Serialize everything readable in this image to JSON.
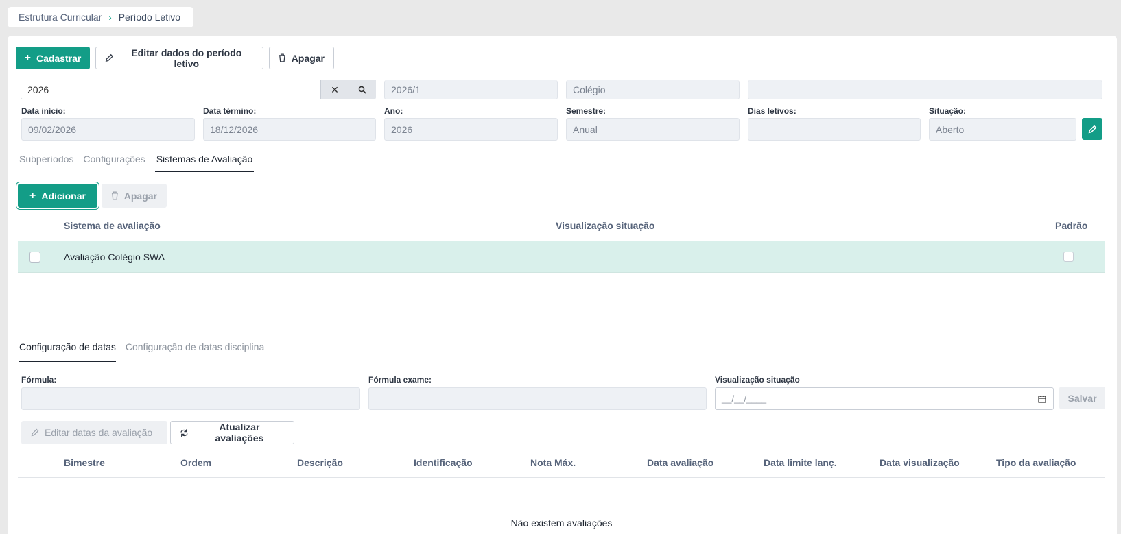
{
  "breadcrumb": {
    "root": "Estrutura Curricular",
    "separator": "›",
    "current": "Período Letivo"
  },
  "toolbar": {
    "register_label": "Cadastrar",
    "edit_label": "Editar dados do período letivo",
    "delete_label": "Apagar"
  },
  "period": {
    "search_value": "2026",
    "code": "2026/1",
    "type": "Colégio",
    "extra": "",
    "start_label": "Data início:",
    "start_value": "09/02/2026",
    "end_label": "Data término:",
    "end_value": "18/12/2026",
    "year_label": "Ano:",
    "year_value": "2026",
    "semester_label": "Semestre:",
    "semester_value": "Anual",
    "school_days_label": "Dias letivos:",
    "school_days_value": "",
    "status_label": "Situação:",
    "status_value": "Aberto"
  },
  "tabs": [
    {
      "label": "Subperíodos",
      "active": false
    },
    {
      "label": "Configurações",
      "active": false
    },
    {
      "label": "Sistemas de Avaliação",
      "active": true
    }
  ],
  "eval_systems": {
    "add_label": "Adicionar",
    "delete_label": "Apagar",
    "columns": [
      "Sistema de avaliação",
      "Visualização situação",
      "Padrão"
    ],
    "rows": [
      {
        "name": "Avaliação Colégio SWA",
        "visualization": "",
        "default": false
      }
    ]
  },
  "date_tabs": [
    {
      "label": "Configuração de datas",
      "active": true
    },
    {
      "label": "Configuração de datas disciplina",
      "active": false
    }
  ],
  "date_config": {
    "formula_label": "Fórmula:",
    "formula_value": "",
    "exam_formula_label": "Fórmula exame:",
    "exam_formula_value": "",
    "visualization_label": "Visualização situação",
    "visualization_placeholder": "__/__/____",
    "save_label": "Salvar",
    "edit_dates_label": "Editar datas da avaliação",
    "update_label": "Atualizar avaliações"
  },
  "assessments": {
    "columns": [
      "Bimestre",
      "Ordem",
      "Descrição",
      "Identificação",
      "Nota Máx.",
      "Data avaliação",
      "Data limite lanç.",
      "Data visualização",
      "Tipo da avaliação"
    ],
    "empty_text": "Não existem avaliações"
  },
  "colors": {
    "accent": "#139d87",
    "selected_row": "#d9f0eb"
  }
}
